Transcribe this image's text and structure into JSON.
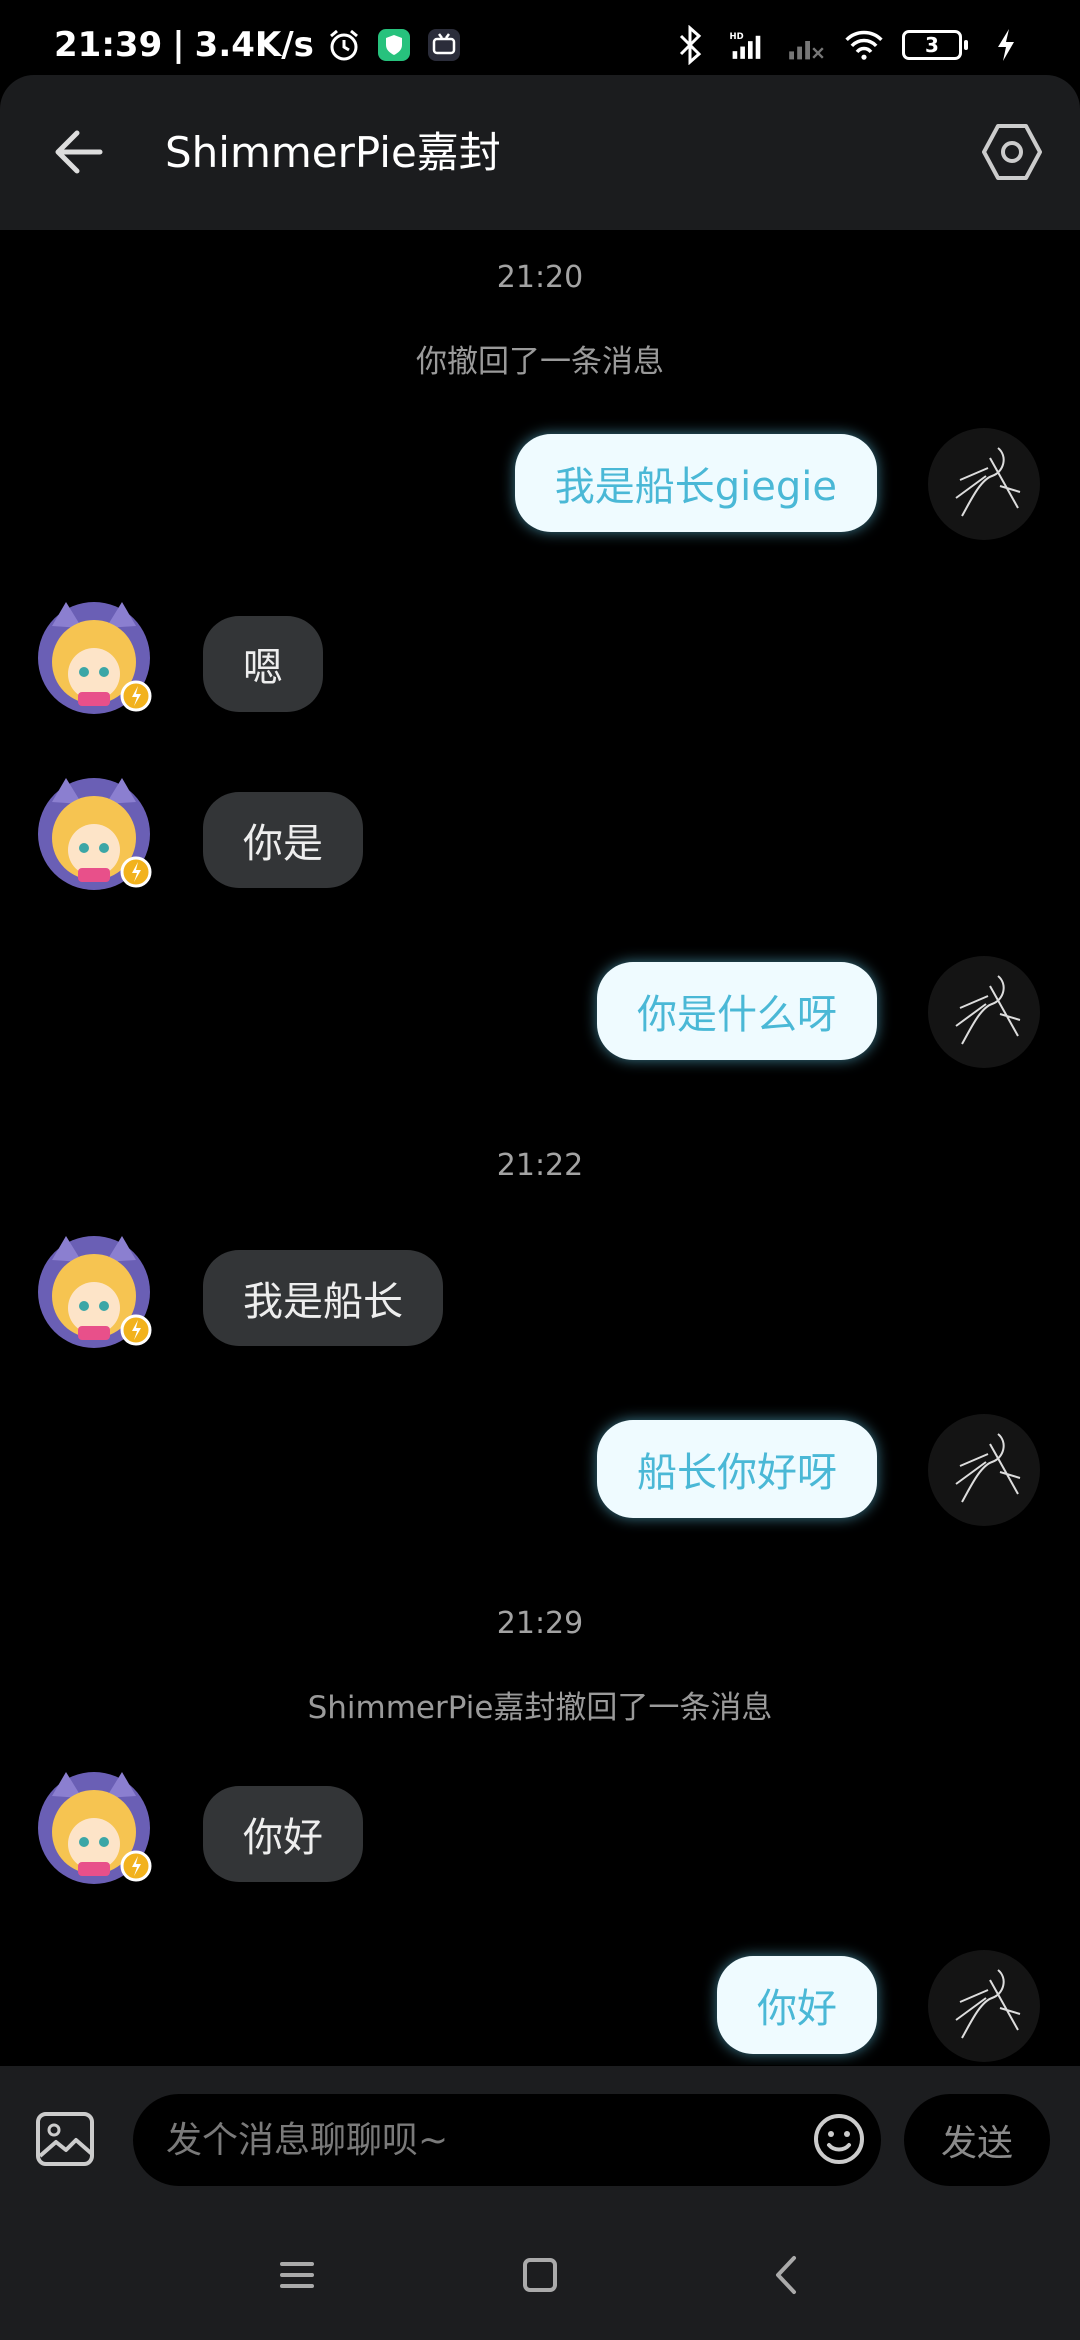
{
  "status_bar": {
    "time": "21:39",
    "separator": "|",
    "net_speed": "3.4K/s",
    "battery": "3",
    "icons": [
      "alarm-icon",
      "shield-app-icon",
      "bilibili-icon",
      "bluetooth-icon",
      "hd-signal-icon",
      "signal-off-icon",
      "wifi-icon",
      "battery-icon",
      "charging-icon"
    ]
  },
  "header": {
    "title": "ShimmerPie嘉封",
    "back_icon": "arrow-left-icon",
    "settings_icon": "hexagon-gear-icon"
  },
  "messages": [
    {
      "type": "time",
      "text": "21:20"
    },
    {
      "type": "system",
      "text": "你撤回了一条消息"
    },
    {
      "type": "out",
      "text": "我是船长giegie"
    },
    {
      "type": "in",
      "text": "嗯"
    },
    {
      "type": "in",
      "text": "你是"
    },
    {
      "type": "out",
      "text": "你是什么呀"
    },
    {
      "type": "time",
      "text": "21:22"
    },
    {
      "type": "in",
      "text": "我是船长"
    },
    {
      "type": "out",
      "text": "船长你好呀"
    },
    {
      "type": "time",
      "text": "21:29"
    },
    {
      "type": "system",
      "text": "ShimmerPie嘉封撤回了一条消息"
    },
    {
      "type": "in",
      "text": "你好"
    },
    {
      "type": "out",
      "text": "你好"
    }
  ],
  "input": {
    "placeholder": "发个消息聊聊呗~",
    "send_label": "发送",
    "image_icon": "image-icon",
    "emoji_icon": "smile-icon"
  },
  "colors": {
    "background": "#000000",
    "header_bg": "#1b1c1e",
    "incoming_bubble": "#333537",
    "outgoing_bubble": "#effbff",
    "outgoing_text": "#4ab8d6",
    "input_bar": "#1c1d1f"
  }
}
